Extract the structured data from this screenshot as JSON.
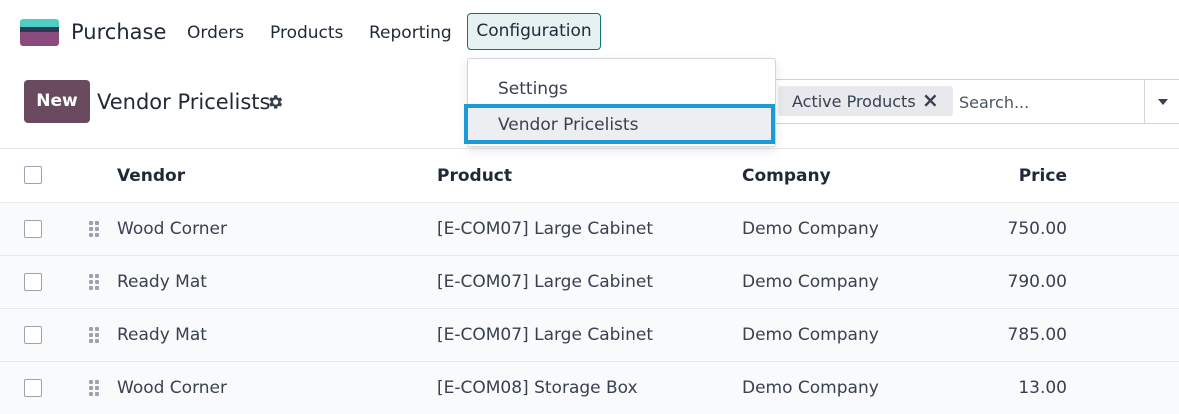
{
  "app": {
    "name": "Purchase",
    "logo_icon": "purchase-app-icon",
    "colors": {
      "teal": "#4ecdc4",
      "navy": "#2b3a55",
      "plum": "#8a4a7e"
    }
  },
  "nav": {
    "orders": "Orders",
    "products": "Products",
    "reporting": "Reporting",
    "configuration": "Configuration"
  },
  "dropdown": {
    "settings": "Settings",
    "vendor_pricelists": "Vendor Pricelists",
    "selected": "Vendor Pricelists"
  },
  "control": {
    "new_label": "New",
    "title": "Vendor Pricelists",
    "settings_icon": "gear-icon",
    "brand_color": "#6a4a5f"
  },
  "search": {
    "facet": "Active Products",
    "remove_icon": "close-icon",
    "placeholder": "Search...",
    "toggle_icon": "caret-down-icon"
  },
  "table": {
    "headers": {
      "vendor": "Vendor",
      "product": "Product",
      "company": "Company",
      "price": "Price"
    },
    "rows": [
      {
        "vendor": "Wood Corner",
        "product": "[E-COM07] Large Cabinet",
        "company": "Demo Company",
        "price": "750.00"
      },
      {
        "vendor": "Ready Mat",
        "product": "[E-COM07] Large Cabinet",
        "company": "Demo Company",
        "price": "790.00"
      },
      {
        "vendor": "Ready Mat",
        "product": "[E-COM07] Large Cabinet",
        "company": "Demo Company",
        "price": "785.00"
      },
      {
        "vendor": "Wood Corner",
        "product": "[E-COM08] Storage Box",
        "company": "Demo Company",
        "price": "13.00"
      }
    ]
  },
  "highlight_color": "#1a9ad6"
}
